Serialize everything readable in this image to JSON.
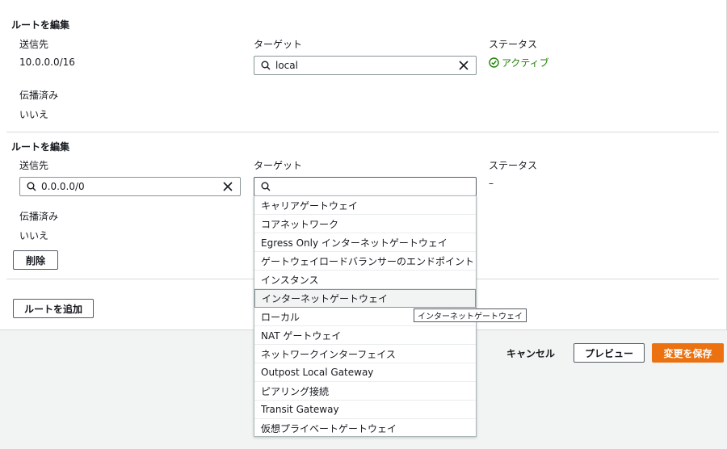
{
  "route1": {
    "heading": "ルートを編集",
    "destination_label": "送信先",
    "destination_value": "10.0.0.0/16",
    "target_label": "ターゲット",
    "target_value": "local",
    "status_label": "ステータス",
    "status_value": "アクティブ",
    "propagated_label": "伝播済み",
    "propagated_value": "いいえ"
  },
  "route2": {
    "heading": "ルートを編集",
    "destination_label": "送信先",
    "destination_value": "0.0.0.0/0",
    "target_label": "ターゲット",
    "target_value": "",
    "status_label": "ステータス",
    "status_value": "–",
    "propagated_label": "伝播済み",
    "propagated_value": "いいえ",
    "delete_label": "削除"
  },
  "add_route_label": "ルートを追加",
  "dropdown": {
    "items": [
      "キャリアゲートウェイ",
      "コアネットワーク",
      "Egress Only インターネットゲートウェイ",
      "ゲートウェイロードバランサーのエンドポイント",
      "インスタンス",
      "インターネットゲートウェイ",
      "ローカル",
      "NAT ゲートウェイ",
      "ネットワークインターフェイス",
      "Outpost Local Gateway",
      "ピアリング接続",
      "Transit Gateway",
      "仮想プライベートゲートウェイ"
    ],
    "hovered_index": 5
  },
  "tooltip": "インターネットゲートウェイ",
  "footer": {
    "cancel_label": "キャンセル",
    "preview_label": "プレビュー",
    "save_label": "変更を保存"
  },
  "colors": {
    "primary": "#ec7211",
    "success": "#1d8102"
  }
}
